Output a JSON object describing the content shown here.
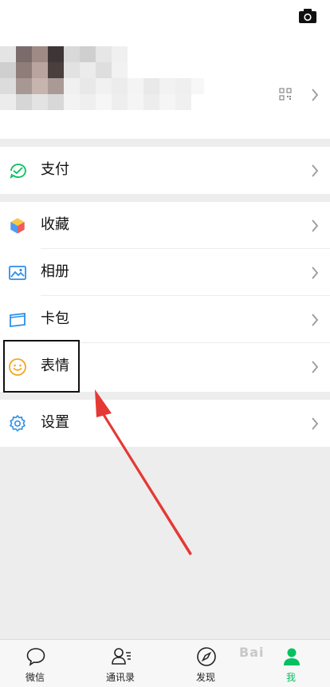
{
  "menu": {
    "pay": {
      "label": "支付",
      "icon": "wechat-pay-icon"
    },
    "favorites": {
      "label": "收藏",
      "icon": "cube-icon"
    },
    "album": {
      "label": "相册",
      "icon": "image-icon"
    },
    "cards": {
      "label": "卡包",
      "icon": "card-wallet-icon"
    },
    "stickers": {
      "label": "表情",
      "icon": "smiley-icon"
    },
    "settings": {
      "label": "设置",
      "icon": "gear-icon"
    }
  },
  "tabbar": {
    "items": [
      {
        "label": "微信",
        "icon": "chat-bubble-icon"
      },
      {
        "label": "通讯录",
        "icon": "contacts-icon"
      },
      {
        "label": "发现",
        "icon": "compass-icon"
      },
      {
        "label": "我",
        "icon": "person-icon",
        "active": true
      }
    ]
  },
  "watermark": {
    "text": "Bai"
  },
  "colors": {
    "accent_green": "#07c160",
    "annotation_red": "#e53935"
  }
}
